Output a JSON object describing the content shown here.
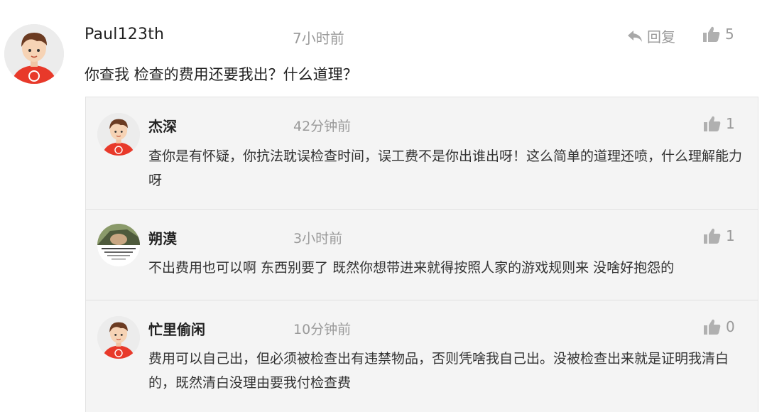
{
  "main_comment": {
    "avatar": "cartoon-boy-avatar",
    "author": "Paul123th",
    "time": "7小时前",
    "reply_label": "回复",
    "likes": "5",
    "text": "你查我 检查的费用还要我出？什么道理？"
  },
  "replies": [
    {
      "avatar": "cartoon-boy-avatar",
      "author": "杰深",
      "time": "42分钟前",
      "likes": "1",
      "text": "查你是有怀疑，你抗法耽误检查时间，误工费不是你出谁出呀！这么简单的道理还喷，什么理解能力呀"
    },
    {
      "avatar": "car-photo-avatar",
      "author": "朔漠",
      "time": "3小时前",
      "likes": "1",
      "text": "不出费用也可以啊 东西别要了 既然你想带进来就得按照人家的游戏规则来 没啥好抱怨的"
    },
    {
      "avatar": "cartoon-boy-avatar",
      "author": "忙里偷闲",
      "time": "10分钟前",
      "likes": "0",
      "text": "费用可以自己出，但必须被检查出有违禁物品，否则凭啥我自己出。没被检查出来就是证明我清白的，既然清白没理由要我付检查费"
    }
  ],
  "colors": {
    "meta_gray": "#9a9a9a",
    "reply_bg": "#f4f4f4",
    "avatar_shirt": "#e8392a"
  }
}
